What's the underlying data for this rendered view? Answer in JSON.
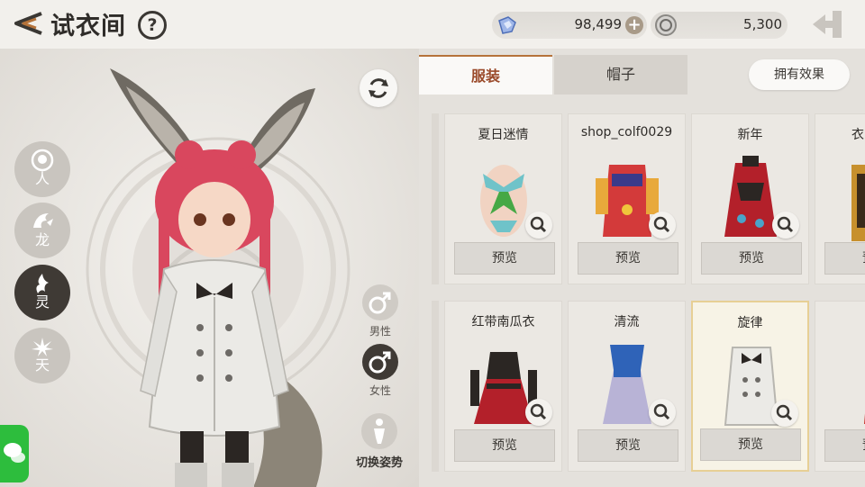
{
  "header": {
    "title": "试衣间",
    "help_label": "?",
    "currency1": {
      "amount": "98,499",
      "icon": "blue-crystal-icon"
    },
    "currency2": {
      "amount": "5,300",
      "icon": "silver-coin-icon"
    }
  },
  "scene": {
    "races": [
      {
        "label": "人",
        "icon": "human-mask-icon",
        "active": false
      },
      {
        "label": "龙",
        "icon": "dragon-icon",
        "active": false
      },
      {
        "label": "灵",
        "icon": "spirit-icon",
        "active": true
      },
      {
        "label": "天",
        "icon": "heaven-lotus-icon",
        "active": false
      }
    ],
    "genders": [
      {
        "label": "男性",
        "symbol": "♂",
        "active": false
      },
      {
        "label": "女性",
        "symbol": "♂",
        "active": true
      }
    ],
    "pose_label": "切换姿势"
  },
  "panel": {
    "tabs": [
      {
        "label": "服装",
        "active": true
      },
      {
        "label": "帽子",
        "active": false
      }
    ],
    "effect_button": "拥有效果",
    "preview_label": "预览",
    "items": [
      {
        "name": "夏日迷情",
        "row": 0,
        "col": 0,
        "selected": false
      },
      {
        "name": "shop_colf0029",
        "row": 0,
        "col": 1,
        "selected": false
      },
      {
        "name": "新年",
        "row": 0,
        "col": 2,
        "selected": false
      },
      {
        "name": "衣",
        "row": 0,
        "col": 3,
        "selected": false
      },
      {
        "name": "红带南瓜衣",
        "row": 1,
        "col": 0,
        "selected": false
      },
      {
        "name": "清流",
        "row": 1,
        "col": 1,
        "selected": false
      },
      {
        "name": "旋律",
        "row": 1,
        "col": 2,
        "selected": true
      },
      {
        "name": "",
        "row": 1,
        "col": 3,
        "selected": false
      }
    ]
  },
  "colors": {
    "accent": "#9a4a2a",
    "active_dark": "#3f3a35",
    "selected_border": "#e7cf95",
    "chat_green": "#2dbd3d"
  }
}
